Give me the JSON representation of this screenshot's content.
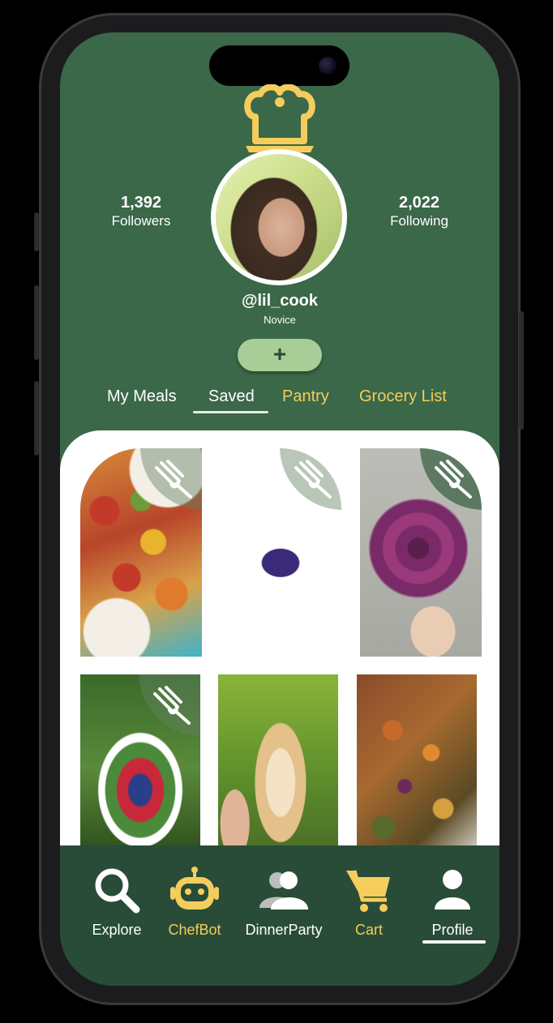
{
  "profile": {
    "followers_count": "1,392",
    "followers_label": "Followers",
    "following_count": "2,022",
    "following_label": "Following",
    "username": "@lil_cook",
    "rank": "Novice",
    "add_label": "+"
  },
  "tabs": [
    {
      "label": "My Meals",
      "active": false
    },
    {
      "label": "Saved",
      "active": true
    },
    {
      "label": "Pantry",
      "active": false
    },
    {
      "label": "Grocery List",
      "active": false
    }
  ],
  "posts": [
    {
      "name": "heirloom-tomato-burrata-salad"
    },
    {
      "name": "blueberry-crepes"
    },
    {
      "name": "purple-rose-tart"
    },
    {
      "name": "berry-spinach-salad"
    },
    {
      "name": "layered-dessert-jar"
    },
    {
      "name": "roasted-vegetable-tray"
    }
  ],
  "nav": [
    {
      "label": "Explore",
      "icon": "search-icon"
    },
    {
      "label": "ChefBot",
      "icon": "robot-icon"
    },
    {
      "label": "DinnerParty",
      "icon": "group-icon"
    },
    {
      "label": "Cart",
      "icon": "cart-icon"
    },
    {
      "label": "Profile",
      "icon": "person-icon"
    }
  ],
  "colors": {
    "background": "#3a6848",
    "nav_background": "#284c37",
    "accent_gold": "#f4cd5c",
    "add_button": "#a9cd96"
  }
}
